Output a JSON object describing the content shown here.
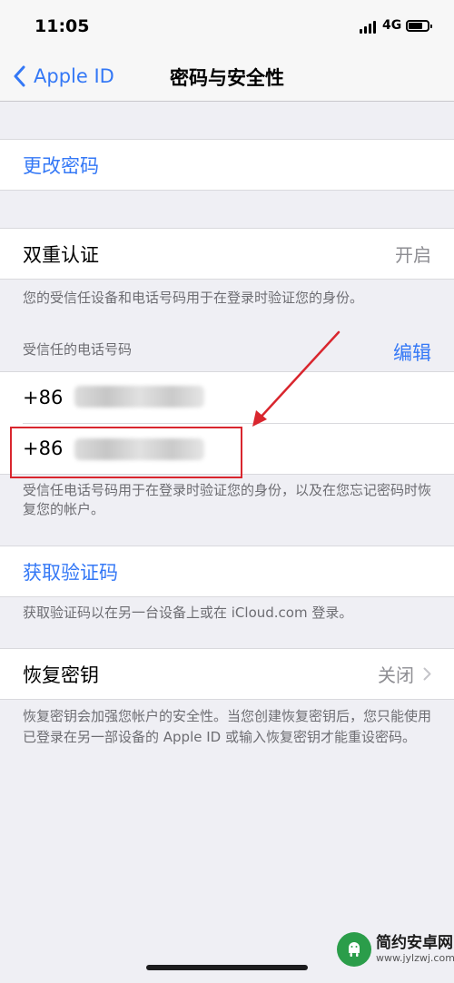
{
  "status_bar": {
    "time": "11:05",
    "network": "4G"
  },
  "nav": {
    "back_label": "Apple ID",
    "title": "密码与安全性"
  },
  "change_password": {
    "label": "更改密码"
  },
  "two_factor": {
    "label": "双重认证",
    "value": "开启",
    "description": "您的受信任设备和电话号码用于在登录时验证您的身份。",
    "trusted_header": "受信任的电话号码",
    "edit_label": "编辑",
    "phone_numbers": [
      "+86",
      "+86"
    ],
    "phone_footnote": "受信任电话号码用于在登录时验证您的身份，以及在您忘记密码时恢复您的帐户。"
  },
  "get_code": {
    "label": "获取验证码",
    "footnote": "获取验证码以在另一台设备上或在 iCloud.com 登录。"
  },
  "recovery_key": {
    "label": "恢复密钥",
    "value": "关闭",
    "footnote": "恢复密钥会加强您帐户的安全性。当您创建恢复密钥后，您只能使用已登录在另一部设备的 Apple ID 或输入恢复密钥才能重设密码。"
  },
  "watermark": {
    "title": "简约安卓网",
    "url": "www.jylzwj.com"
  },
  "colors": {
    "accent": "#3478f6",
    "annotation": "#d9262e",
    "background": "#efeff4"
  }
}
